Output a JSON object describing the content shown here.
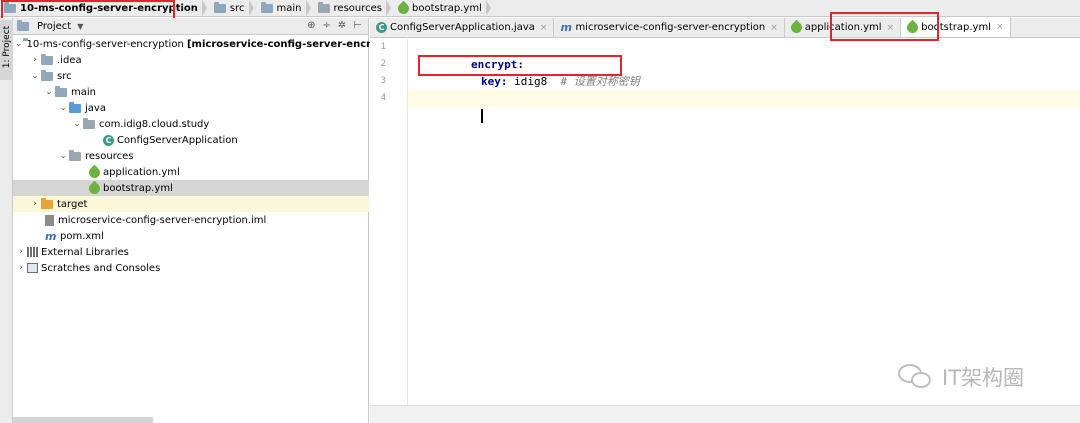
{
  "breadcrumb": {
    "project": "10-ms-config-server-encryption",
    "src": "src",
    "main": "main",
    "resources": "resources",
    "file": "bootstrap.yml"
  },
  "tool_strip": {
    "tab_label": "1: Project"
  },
  "project_panel": {
    "title": "Project",
    "tree": [
      {
        "label": "10-ms-config-server-encryption",
        "suffix": "[microservice-config-server-encryption]"
      },
      {
        "label": ".idea"
      },
      {
        "label": "src"
      },
      {
        "label": "main"
      },
      {
        "label": "java"
      },
      {
        "label": "com.idig8.cloud.study"
      },
      {
        "label": "ConfigServerApplication"
      },
      {
        "label": "resources"
      },
      {
        "label": "application.yml"
      },
      {
        "label": "bootstrap.yml"
      },
      {
        "label": "target"
      },
      {
        "label": "microservice-config-server-encryption.iml"
      },
      {
        "label": "pom.xml"
      },
      {
        "label": "External Libraries"
      },
      {
        "label": "Scratches and Consoles"
      }
    ]
  },
  "editor": {
    "tabs": [
      {
        "label": "ConfigServerApplication.java",
        "icon": "class-icon"
      },
      {
        "label": "microservice-config-server-encryption",
        "icon": "maven-icon"
      },
      {
        "label": "application.yml",
        "icon": "spring-leaf-icon"
      },
      {
        "label": "bootstrap.yml",
        "icon": "spring-leaf-icon"
      }
    ],
    "lines": [
      {
        "num": "1",
        "key": "encrypt:",
        "value": "",
        "comment": ""
      },
      {
        "num": "2",
        "key": "key:",
        "value": " idig8  ",
        "comment": "# 设置对称密钥"
      },
      {
        "num": "3",
        "key": "",
        "value": "",
        "comment": ""
      },
      {
        "num": "4",
        "key": "",
        "value": "",
        "comment": ""
      }
    ]
  },
  "watermark": {
    "text": "IT架构圈"
  },
  "colors": {
    "highlight": "#e0262b",
    "keyword": "#000080",
    "comment": "#808080",
    "current_line": "#fffae3"
  }
}
